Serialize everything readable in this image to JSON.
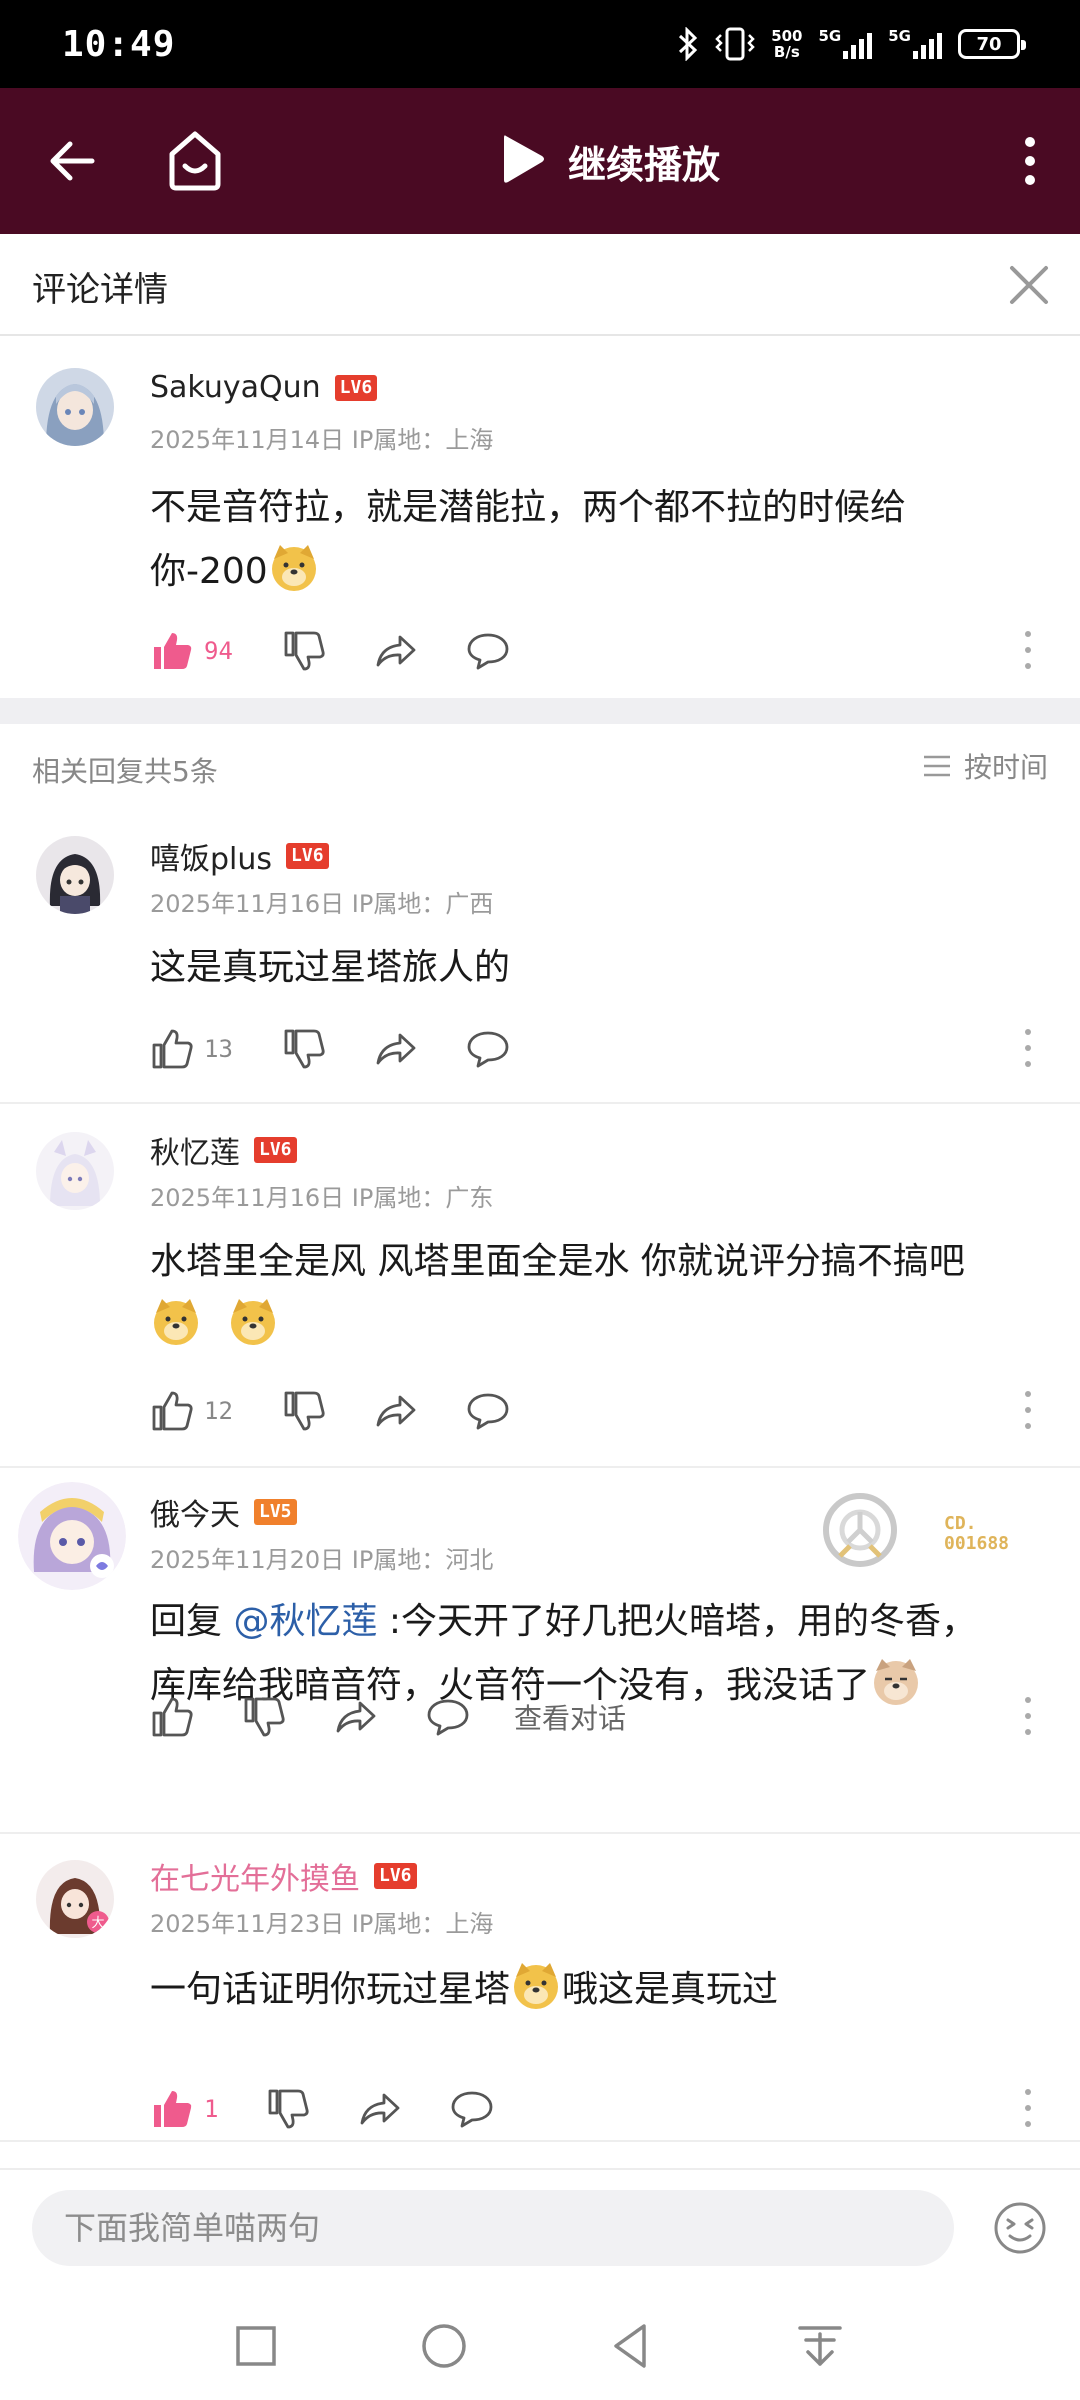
{
  "status_bar": {
    "time": "10:49",
    "net_rate_top": "500",
    "net_rate_bottom": "B/s",
    "sim1": "5G",
    "sim2": "5G",
    "battery": "70"
  },
  "app_bar": {
    "title": "继续播放",
    "icons": [
      "back-arrow-icon",
      "home-icon",
      "play-icon",
      "more-vert-icon"
    ]
  },
  "detail_header": {
    "title": "评论详情"
  },
  "main_comment": {
    "username": "SakuyaQun",
    "level": "LV6",
    "meta": "2025年11月14日 IP属地：上海",
    "text_line1": "不是音符拉，就是潜能拉，两个都不拉的时候给",
    "text_line2": "你-200",
    "likes": "94",
    "liked": true
  },
  "replies_header": {
    "count_text": "相关回复共5条",
    "sort_label": "按时间"
  },
  "replies": [
    {
      "username": "嘻饭plus",
      "level": "LV6",
      "meta": "2025年11月16日 IP属地：广西",
      "text": "这是真玩过星塔旅人的",
      "likes": "13"
    },
    {
      "username": "秋忆莲",
      "level": "LV6",
      "meta": "2025年11月16日 IP属地：广东",
      "text": "水塔里全是风 风塔里面全是水 你就说评分搞不搞吧",
      "likes": "12"
    },
    {
      "username": "俄今天",
      "level": "LV5",
      "meta": "2025年11月20日 IP属地：河北",
      "reply_prefix": "回复 ",
      "mention": "@秋忆莲",
      "text_line1": " :今天开了好几把火暗塔，用的冬香，",
      "text_line2": "库库给我暗音符，火音符一个没有，我没话了",
      "view_conversation": "查看对话",
      "badge_line1": "CD.",
      "badge_line2": "001688"
    },
    {
      "username": "在七光年外摸鱼",
      "level": "LV6",
      "meta": "2025年11月23日 IP属地：上海",
      "text_before": "一句话证明你玩过星塔",
      "text_after": "哦这是真玩过",
      "likes": "1",
      "liked": true
    }
  ],
  "input_bar": {
    "placeholder": "下面我简单喵两句"
  },
  "colors": {
    "app_bar_bg": "#4a0a23",
    "like_active": "#ef5b8d",
    "mention": "#2c5fa8",
    "level6": "#e53d2d",
    "level5": "#f0802c",
    "vip_name": "#e36f98"
  }
}
